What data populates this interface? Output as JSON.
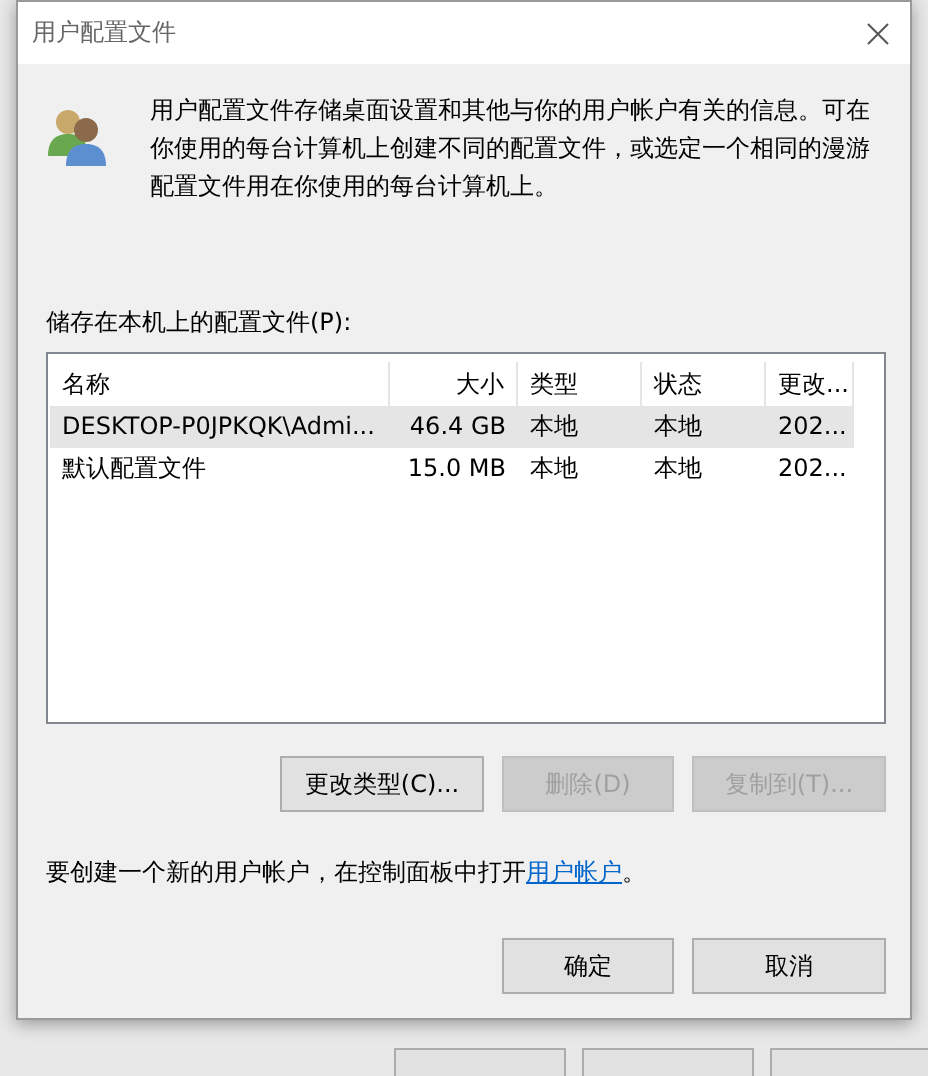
{
  "window": {
    "title": "用户配置文件"
  },
  "description": "用户配置文件存储桌面设置和其他与你的用户帐户有关的信息。可在你使用的每台计算机上创建不同的配置文件，或选定一个相同的漫游配置文件用在你使用的每台计算机上。",
  "list_label": "储存在本机上的配置文件(P):",
  "table": {
    "columns": [
      {
        "label": "名称"
      },
      {
        "label": "大小"
      },
      {
        "label": "类型"
      },
      {
        "label": "状态"
      },
      {
        "label": "更改..."
      }
    ],
    "rows": [
      {
        "cells": [
          "DESKTOP-P0JPKQK\\Admi...",
          "46.4 GB",
          "本地",
          "本地",
          "202..."
        ],
        "selected": true
      },
      {
        "cells": [
          "默认配置文件",
          "15.0 MB",
          "本地",
          "本地",
          "202..."
        ],
        "selected": false
      }
    ]
  },
  "actions": [
    {
      "label": "更改类型(C)...",
      "disabled": false
    },
    {
      "label": "删除(D)",
      "disabled": true
    },
    {
      "label": "复制到(T)...",
      "disabled": true
    }
  ],
  "footer": {
    "text": "要创建一个新的用户帐户，在控制面板中打开",
    "link": "用户帐户",
    "end": "。"
  },
  "dialog_buttons": [
    {
      "label": "确定"
    },
    {
      "label": "取消"
    }
  ]
}
